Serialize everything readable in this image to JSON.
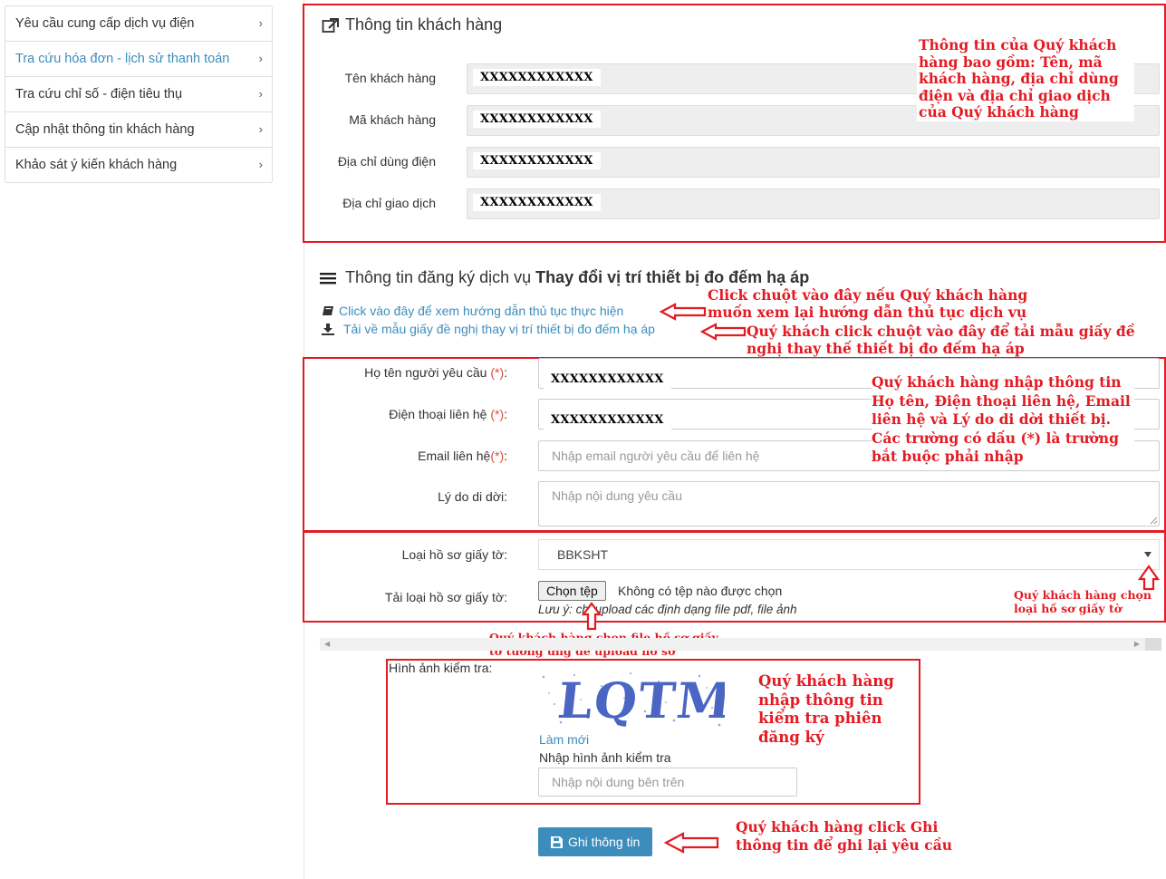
{
  "sidebar": {
    "items": [
      {
        "label": "Yêu cầu cung cấp dịch vụ điện"
      },
      {
        "label": "Tra cứu hóa đơn - lịch sử thanh toán"
      },
      {
        "label": "Tra cứu chỉ số - điện tiêu thụ"
      },
      {
        "label": "Cập nhật thông tin khách hàng"
      },
      {
        "label": "Khảo sát ý kiến khách hàng"
      }
    ],
    "chevron": "›"
  },
  "customer": {
    "title": "Thông tin khách hàng",
    "fields": [
      {
        "label": "Tên khách hàng",
        "value": "XXXXXXXXXXXX"
      },
      {
        "label": "Mã khách hàng",
        "value": "XXXXXXXXXXXX"
      },
      {
        "label": "Địa chỉ dùng điện",
        "value": "XXXXXXXXXXXX"
      },
      {
        "label": "Địa chỉ giao dịch",
        "value": "XXXXXXXXXXXX"
      }
    ],
    "annotation": "Thông tin của Quý khách hàng bao gồm: Tên, mã khách hàng, địa chỉ dùng điện và địa chỉ giao dịch của Quý khách hàng"
  },
  "service": {
    "title_prefix": "Thông tin đăng ký dịch vụ",
    "title_bold": "Thay đổi vị trí thiết bị đo đếm hạ áp",
    "guide_link": "Click vào đây để xem hướng dẫn thủ tục thực hiện",
    "download_link": "Tải về mẫu giấy đề nghị thay vị trí thiết bị đo đếm hạ áp",
    "annotation_guide": "Click chuột vào đây nếu Quý khách hàng muốn xem lại hướng dẫn thủ tục dịch vụ",
    "annotation_download": "Quý khách click chuột vào đây để tải mẫu giấy đề nghị thay thế thiết bị đo đếm hạ áp"
  },
  "form": {
    "required_mark": "(*)",
    "name_label": "Họ tên người yêu cầu",
    "name_value": "XXXXXXXXXXXX",
    "phone_label": "Điện thoại liên hệ",
    "phone_value": "XXXXXXXXXXXX",
    "email_label": "Email liên hệ",
    "email_placeholder": "Nhập email người yêu cầu để liên hệ",
    "reason_label": "Lý do di dời:",
    "reason_placeholder": "Nhập nội dung yêu cầu",
    "colon": ":",
    "annotation": "Quý khách hàng nhập thông tin Họ tên, Điện thoại liên hệ, Email liên hệ và Lý do di dời thiết bị. Các trường có dấu (*) là trường bắt buộc phải nhập"
  },
  "documents": {
    "type_label": "Loại hồ sơ giấy tờ:",
    "type_value": "BBKSHT",
    "upload_label": "Tải loại hồ sơ giấy tờ:",
    "choose_file": "Chọn tệp",
    "no_file": "Không có tệp nào được chọn",
    "note": "Lưu ý: chỉ upload các định dạng file pdf, file ảnh",
    "annotation_type": "Quý khách hàng chọn loại hồ sơ giấy tờ",
    "annotation_file": "Quý khách hàng chọn file hồ sơ giấy tờ tương ứng để upload hồ sơ"
  },
  "captcha": {
    "label": "Hình ảnh kiểm tra:",
    "code": "LQTM",
    "refresh": "Làm mới",
    "input_label": "Nhập hình ảnh kiểm tra",
    "input_placeholder": "Nhập nội dung bên trên",
    "annotation": "Quý khách hàng nhập thông tin kiểm tra phiên đăng ký"
  },
  "save": {
    "label": "Ghi thông tin",
    "annotation": "Quý khách hàng click Ghi thông tin để ghi lại yêu cầu"
  },
  "colors": {
    "accent": "#3c8dbc",
    "annotation_red": "#e31b23",
    "captcha_blue": "#1f3fb5"
  }
}
